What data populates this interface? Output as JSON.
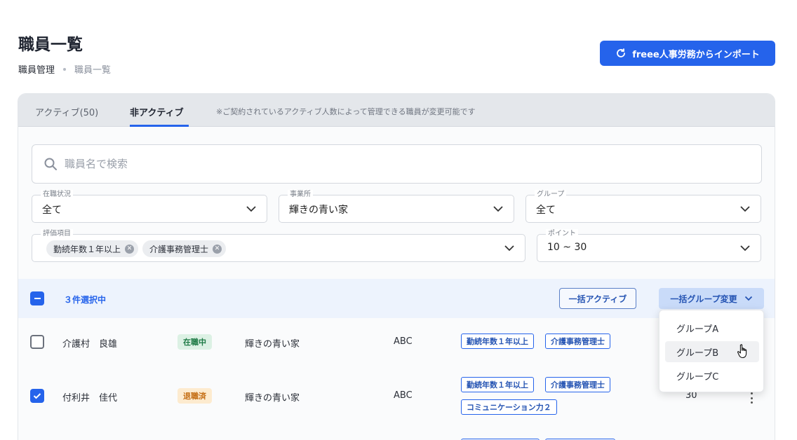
{
  "header": {
    "title": "職員一覧",
    "breadcrumb": [
      "職員管理",
      "職員一覧"
    ],
    "import_button": "freee人事労務からインポート"
  },
  "tabs": {
    "active_label": "アクティブ(50)",
    "inactive_label": "非アクティブ",
    "selected": "非アクティブ",
    "note": "※ご契約されているアクティブ人数によって管理できる職員が変更可能です"
  },
  "search": {
    "placeholder": "職員名で検索"
  },
  "filters": {
    "status": {
      "label": "在職状況",
      "value": "全て"
    },
    "office": {
      "label": "事業所",
      "value": "輝きの青い家"
    },
    "group": {
      "label": "グループ",
      "value": "全て"
    },
    "evaluation": {
      "label": "評価項目",
      "chips": [
        "勤続年数１年以上",
        "介護事務管理士"
      ]
    },
    "points": {
      "label": "ポイント",
      "value": "10 ~ 30"
    }
  },
  "bulk": {
    "selected_text": "３件選択中",
    "activate_button": "一括アクティブ",
    "group_change_button": "一括グループ変更"
  },
  "rows": [
    {
      "name": "介護村　良雄",
      "status": "在職中",
      "office": "輝きの青い家",
      "group": "ABC",
      "tags": [
        "勤続年数１年以上",
        "介護事務管理士"
      ],
      "points": "",
      "checked": false
    },
    {
      "name": "付利井　佳代",
      "status": "退職済",
      "office": "輝きの青い家",
      "group": "ABC",
      "tags": [
        "勤続年数１年以上",
        "介護事務管理士",
        "コミュニケーション力２"
      ],
      "points": "30",
      "checked": true
    }
  ],
  "group_menu": {
    "items": [
      "グループA",
      "グループB",
      "グループC"
    ],
    "hovered": "グループB"
  },
  "colors": {
    "primary": "#2563eb",
    "active_badge": "#dcf1e4",
    "retired_badge": "#fdebcf"
  }
}
